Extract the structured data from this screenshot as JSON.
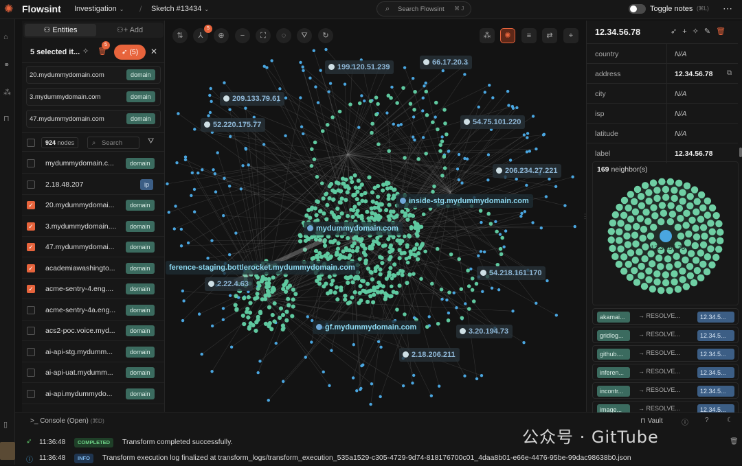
{
  "app": {
    "title": "Flowsint"
  },
  "header": {
    "investigation": "Investigation",
    "sketch": "Sketch #13434",
    "search_placeholder": "Search Flowsint",
    "search_shortcut": "⌘ J",
    "toggle_notes": "Toggle notes",
    "toggle_notes_shortcut": "(⌘L)"
  },
  "left": {
    "tab_entities": "Entities",
    "tab_add": "Add",
    "selected_text": "5 selected it...",
    "delete_badge": "5",
    "run_button": "(5)",
    "selected_cards": [
      {
        "label": "20.mydummydomain.com",
        "type": "domain"
      },
      {
        "label": "3.mydummydomain.com",
        "type": "domain"
      },
      {
        "label": "47.mydummydomain.com",
        "type": "domain"
      }
    ],
    "node_count": "924",
    "node_count_label": "nodes",
    "search_placeholder": "Search",
    "rows": [
      {
        "label": "mydummydomain.c...",
        "type": "domain",
        "checked": false
      },
      {
        "label": "2.18.48.207",
        "type": "ip",
        "checked": false
      },
      {
        "label": "20.mydummydomai...",
        "type": "domain",
        "checked": true
      },
      {
        "label": "3.mydummydomain....",
        "type": "domain",
        "checked": true
      },
      {
        "label": "47.mydummydomai...",
        "type": "domain",
        "checked": true
      },
      {
        "label": "academiawashingto...",
        "type": "domain",
        "checked": true
      },
      {
        "label": "acme-sentry-4.eng....",
        "type": "domain",
        "checked": true
      },
      {
        "label": "acme-sentry-4a.eng...",
        "type": "domain",
        "checked": false
      },
      {
        "label": "acs2-poc.voice.myd...",
        "type": "domain",
        "checked": false
      },
      {
        "label": "ai-api-stg.mydumm...",
        "type": "domain",
        "checked": false
      },
      {
        "label": "ai-api-uat.mydumm...",
        "type": "domain",
        "checked": false
      },
      {
        "label": "ai-api.mydummydo...",
        "type": "domain",
        "checked": false
      }
    ]
  },
  "toolbar": {
    "transform_badge": "5"
  },
  "graph": {
    "labels": [
      {
        "text": "199.120.51.239",
        "kind": "ip"
      },
      {
        "text": "66.17.20.3",
        "kind": "ip"
      },
      {
        "text": "209.133.79.61",
        "kind": "ip"
      },
      {
        "text": "52.220.175.77",
        "kind": "ip"
      },
      {
        "text": "54.75.101.220",
        "kind": "ip"
      },
      {
        "text": "206.234.27.221",
        "kind": "ip"
      },
      {
        "text": "inside-stg.mydummydomain.com",
        "kind": "domain"
      },
      {
        "text": "mydummydomain.com",
        "kind": "domain"
      },
      {
        "text": "ference-staging.bottlerocket.mydummydomain.com",
        "kind": "domain"
      },
      {
        "text": "2.22.4.63",
        "kind": "ip"
      },
      {
        "text": "54.218.161.170",
        "kind": "ip"
      },
      {
        "text": "gf.mydummydomain.com",
        "kind": "domain"
      },
      {
        "text": "3.20.194.73",
        "kind": "ip"
      },
      {
        "text": "2.18.206.211",
        "kind": "ip"
      }
    ]
  },
  "right": {
    "title": "12.34.56.78",
    "props": [
      {
        "key": "country",
        "value": "N/A"
      },
      {
        "key": "address",
        "value": "12.34.56.78"
      },
      {
        "key": "city",
        "value": "N/A"
      },
      {
        "key": "isp",
        "value": "N/A"
      },
      {
        "key": "latitude",
        "value": "N/A"
      },
      {
        "key": "label",
        "value": "12.34.56.78"
      }
    ],
    "neighbors_count": "169",
    "neighbors_label": "neighbor(s)",
    "center_label": "12.34.56.78",
    "relations": [
      {
        "source": "akamai...",
        "rel": "RESOLVE...",
        "target": "12.34.5..."
      },
      {
        "source": "gridlog...",
        "rel": "RESOLVE...",
        "target": "12.34.5..."
      },
      {
        "source": "github....",
        "rel": "RESOLVE...",
        "target": "12.34.5..."
      },
      {
        "source": "inferen...",
        "rel": "RESOLVE...",
        "target": "12.34.5..."
      },
      {
        "source": "incontr...",
        "rel": "RESOLVE...",
        "target": "12.34.5..."
      },
      {
        "source": "image...",
        "rel": "RESOLVE...",
        "target": "12.34.5..."
      }
    ]
  },
  "console": {
    "title": "Console (Open)",
    "shortcut": "(⌘D)",
    "vault": "Vault",
    "logs": [
      {
        "time": "11:36:48",
        "level": "COMPLETED",
        "message": "Transform completed successfully."
      },
      {
        "time": "11:36:48",
        "level": "INFO",
        "message": "Transform execution log finalized at transform_logs/transform_execution_535a1529-c305-4729-9d74-818176700c01_4daa8b01-e66e-4476-95be-99dac98638b0.json"
      }
    ]
  },
  "watermark": "公众号 · GitTube",
  "colors": {
    "accent": "#e8643c",
    "domain_tag": "#3b6b5f",
    "ip_tag": "#3c5e85",
    "node_green": "#5fc9a0",
    "node_blue": "#4aa6e0"
  }
}
